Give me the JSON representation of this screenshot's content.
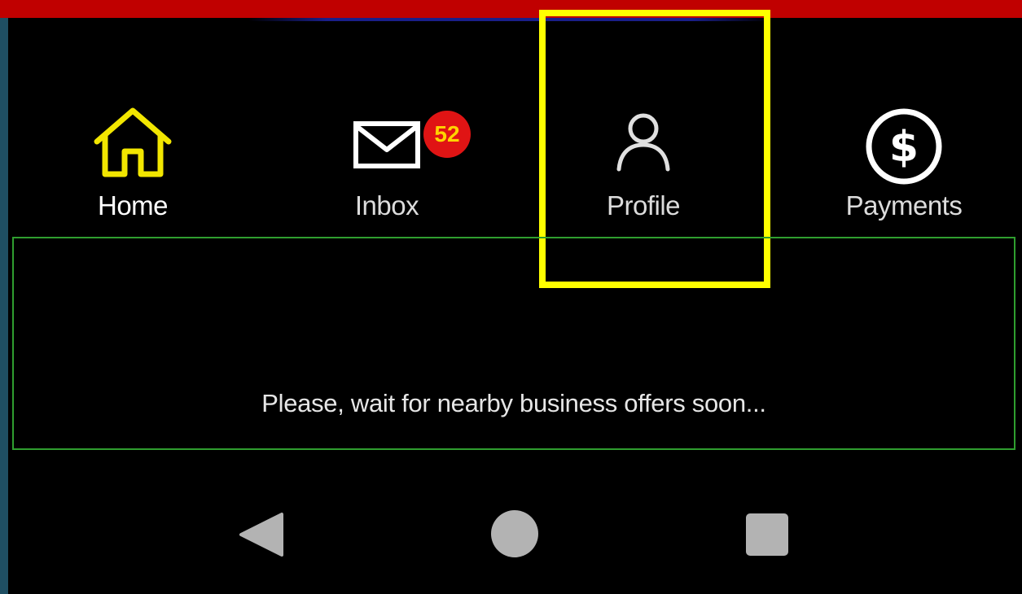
{
  "colors": {
    "status_bar": "#c00000",
    "accent_home": "#f2e600",
    "badge_bg": "#e01414",
    "badge_text": "#ffd400",
    "highlight": "#ffff00",
    "offers_border": "#2f9e2f"
  },
  "nav": {
    "items": [
      {
        "label": "Home",
        "icon": "home-icon",
        "active": true
      },
      {
        "label": "Inbox",
        "icon": "mail-icon",
        "badge": "52"
      },
      {
        "label": "Profile",
        "icon": "person-icon"
      },
      {
        "label": "Payments",
        "icon": "dollar-circle-icon"
      }
    ]
  },
  "offers": {
    "message": "Please, wait for nearby business offers soon..."
  },
  "system_nav": {
    "buttons": [
      "back-icon",
      "home-circle-icon",
      "recents-icon"
    ]
  }
}
